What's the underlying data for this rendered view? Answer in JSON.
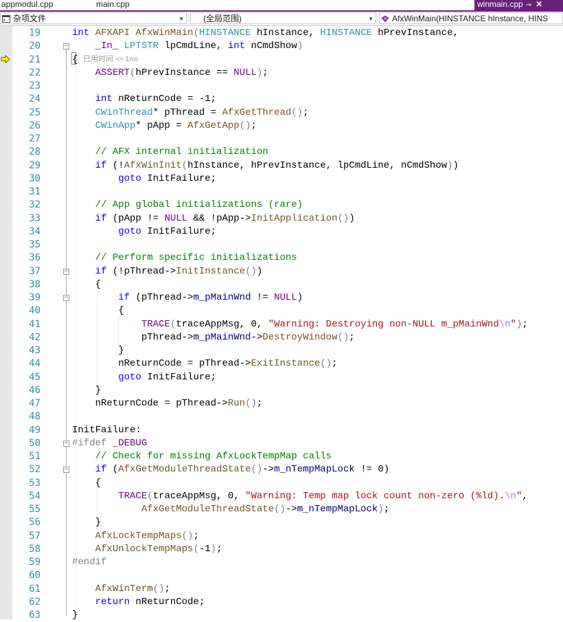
{
  "tabs": [
    {
      "label": "appmodul.cpp",
      "active": false
    },
    {
      "label": "main.cpp",
      "active": false
    },
    {
      "label": "winmain.cpp",
      "active": true
    }
  ],
  "active_tab_color": "#68217a",
  "nav": {
    "project": "杂项文件",
    "scope": "(全局范围)",
    "member": "AfxWinMain(HINSTANCE hInstance, HINS"
  },
  "perf_tip": {
    "label": "已用时间",
    "value": "<= 1ms"
  },
  "line_numbers": [
    "19",
    "20",
    "21",
    "22",
    "23",
    "24",
    "25",
    "26",
    "27",
    "28",
    "29",
    "30",
    "31",
    "32",
    "33",
    "34",
    "35",
    "36",
    "37",
    "38",
    "39",
    "40",
    "41",
    "42",
    "43",
    "44",
    "45",
    "46",
    "47",
    "48",
    "49",
    "50",
    "51",
    "52",
    "53",
    "54",
    "55",
    "56",
    "57",
    "58",
    "59",
    "60",
    "61",
    "62",
    "63"
  ],
  "code_lines": [
    [
      [
        "kw",
        "int "
      ],
      [
        "fn",
        "AFXAPI AfxWinMain"
      ],
      [
        "pa",
        "("
      ],
      [
        "ty",
        "HINSTANCE "
      ],
      [
        "lb",
        "hInstance, "
      ],
      [
        "ty",
        "HINSTANCE "
      ],
      [
        "lb",
        "hPrevInstance,"
      ]
    ],
    [
      [
        "lb",
        "    "
      ],
      [
        "mac",
        "_In_ "
      ],
      [
        "ty",
        "LPTSTR "
      ],
      [
        "lb",
        "lpCmdLine, "
      ],
      [
        "kw",
        "int "
      ],
      [
        "lb",
        "nCmdShow"
      ],
      [
        "pa",
        ")"
      ]
    ],
    [
      [
        "lb",
        "{"
      ]
    ],
    [
      [
        "lb",
        "    "
      ],
      [
        "mac",
        "ASSERT"
      ],
      [
        "pa",
        "("
      ],
      [
        "lb",
        "hPrevInstance == "
      ],
      [
        "mac",
        "NULL"
      ],
      [
        "pa",
        ")"
      ],
      [
        "lb",
        ";"
      ]
    ],
    [],
    [
      [
        "lb",
        "    "
      ],
      [
        "kw",
        "int "
      ],
      [
        "lb",
        "nReturnCode = -1;"
      ]
    ],
    [
      [
        "lb",
        "    "
      ],
      [
        "ty",
        "CWinThread"
      ],
      [
        "lb",
        "* pThread = "
      ],
      [
        "fn",
        "AfxGetThread"
      ],
      [
        "pa",
        "()"
      ],
      [
        "lb",
        ";"
      ]
    ],
    [
      [
        "lb",
        "    "
      ],
      [
        "ty",
        "CWinApp"
      ],
      [
        "lb",
        "* pApp = "
      ],
      [
        "fn",
        "AfxGetApp"
      ],
      [
        "pa",
        "()"
      ],
      [
        "lb",
        ";"
      ]
    ],
    [],
    [
      [
        "lb",
        "    "
      ],
      [
        "cm",
        "// AFX internal initialization"
      ]
    ],
    [
      [
        "lb",
        "    "
      ],
      [
        "kw",
        "if "
      ],
      [
        "lb",
        "(!"
      ],
      [
        "fn",
        "AfxWinInit"
      ],
      [
        "pa",
        "("
      ],
      [
        "lb",
        "hInstance, hPrevInstance, lpCmdLine, nCmdShow"
      ],
      [
        "pa",
        ")"
      ],
      [
        "lb",
        ")"
      ]
    ],
    [
      [
        "lb",
        "        "
      ],
      [
        "kw",
        "goto "
      ],
      [
        "lb",
        "InitFailure;"
      ]
    ],
    [],
    [
      [
        "lb",
        "    "
      ],
      [
        "cm",
        "// App global initializations (rare)"
      ]
    ],
    [
      [
        "lb",
        "    "
      ],
      [
        "kw",
        "if "
      ],
      [
        "lb",
        "(pApp != "
      ],
      [
        "mac",
        "NULL"
      ],
      [
        "lb",
        " && !pApp->"
      ],
      [
        "fn",
        "InitApplication"
      ],
      [
        "pa",
        "()"
      ],
      [
        "lb",
        ")"
      ]
    ],
    [
      [
        "lb",
        "        "
      ],
      [
        "kw",
        "goto "
      ],
      [
        "lb",
        "InitFailure;"
      ]
    ],
    [],
    [
      [
        "lb",
        "    "
      ],
      [
        "cm",
        "// Perform specific initializations"
      ]
    ],
    [
      [
        "lb",
        "    "
      ],
      [
        "kw",
        "if "
      ],
      [
        "lb",
        "(!pThread->"
      ],
      [
        "fn",
        "InitInstance"
      ],
      [
        "pa",
        "()"
      ],
      [
        "lb",
        ")"
      ]
    ],
    [
      [
        "lb",
        "    {"
      ]
    ],
    [
      [
        "lb",
        "        "
      ],
      [
        "kw",
        "if "
      ],
      [
        "lb",
        "(pThread->"
      ],
      [
        "mem",
        "m_pMainWnd"
      ],
      [
        "lb",
        " != "
      ],
      [
        "mac",
        "NULL"
      ],
      [
        "lb",
        ")"
      ]
    ],
    [
      [
        "lb",
        "        {"
      ]
    ],
    [
      [
        "lb",
        "            "
      ],
      [
        "mac",
        "TRACE"
      ],
      [
        "pa",
        "("
      ],
      [
        "lb",
        "traceAppMsg, 0, "
      ],
      [
        "st",
        "\"Warning: Destroying non-NULL m_pMainWnd"
      ],
      [
        "esc",
        "\\n"
      ],
      [
        "st",
        "\""
      ],
      [
        "pa",
        ")"
      ],
      [
        "lb",
        ";"
      ]
    ],
    [
      [
        "lb",
        "            pThread->"
      ],
      [
        "mem",
        "m_pMainWnd"
      ],
      [
        "lb",
        "->"
      ],
      [
        "fn",
        "DestroyWindow"
      ],
      [
        "pa",
        "()"
      ],
      [
        "lb",
        ";"
      ]
    ],
    [
      [
        "lb",
        "        }"
      ]
    ],
    [
      [
        "lb",
        "        nReturnCode = pThread->"
      ],
      [
        "fn",
        "ExitInstance"
      ],
      [
        "pa",
        "()"
      ],
      [
        "lb",
        ";"
      ]
    ],
    [
      [
        "lb",
        "        "
      ],
      [
        "kw",
        "goto "
      ],
      [
        "lb",
        "InitFailure;"
      ]
    ],
    [
      [
        "lb",
        "    }"
      ]
    ],
    [
      [
        "lb",
        "    nReturnCode = pThread->"
      ],
      [
        "fn",
        "Run"
      ],
      [
        "pa",
        "()"
      ],
      [
        "lb",
        ";"
      ]
    ],
    [],
    [
      [
        "lb",
        "InitFailure:"
      ]
    ],
    [
      [
        "pa",
        "#ifdef "
      ],
      [
        "mac",
        "_DEBUG"
      ]
    ],
    [
      [
        "lb",
        "    "
      ],
      [
        "cm",
        "// Check for missing AfxLockTempMap calls"
      ]
    ],
    [
      [
        "lb",
        "    "
      ],
      [
        "kw",
        "if "
      ],
      [
        "lb",
        "("
      ],
      [
        "fn",
        "AfxGetModuleThreadState"
      ],
      [
        "pa",
        "()"
      ],
      [
        "lb",
        "->"
      ],
      [
        "mem",
        "m_nTempMapLock"
      ],
      [
        "lb",
        " != 0)"
      ]
    ],
    [
      [
        "lb",
        "    {"
      ]
    ],
    [
      [
        "lb",
        "        "
      ],
      [
        "mac",
        "TRACE"
      ],
      [
        "pa",
        "("
      ],
      [
        "lb",
        "traceAppMsg, 0, "
      ],
      [
        "st",
        "\"Warning: Temp map lock count non-zero (%ld)."
      ],
      [
        "esc",
        "\\n"
      ],
      [
        "st",
        "\""
      ],
      [
        "lb",
        ","
      ]
    ],
    [
      [
        "lb",
        "            "
      ],
      [
        "fn",
        "AfxGetModuleThreadState"
      ],
      [
        "pa",
        "()"
      ],
      [
        "lb",
        "->"
      ],
      [
        "mem",
        "m_nTempMapLock"
      ],
      [
        "pa",
        ")"
      ],
      [
        "lb",
        ";"
      ]
    ],
    [
      [
        "lb",
        "    }"
      ]
    ],
    [
      [
        "lb",
        "    "
      ],
      [
        "fn",
        "AfxLockTempMaps"
      ],
      [
        "pa",
        "()"
      ],
      [
        "lb",
        ";"
      ]
    ],
    [
      [
        "lb",
        "    "
      ],
      [
        "fn",
        "AfxUnlockTempMaps"
      ],
      [
        "pa",
        "("
      ],
      [
        "lb",
        "-1"
      ],
      [
        "pa",
        ")"
      ],
      [
        "lb",
        ";"
      ]
    ],
    [
      [
        "pa",
        "#endif"
      ]
    ],
    [],
    [
      [
        "lb",
        "    "
      ],
      [
        "fn",
        "AfxWinTerm"
      ],
      [
        "pa",
        "()"
      ],
      [
        "lb",
        ";"
      ]
    ],
    [
      [
        "lb",
        "    "
      ],
      [
        "kw",
        "return "
      ],
      [
        "lb",
        "nReturnCode;"
      ]
    ],
    [
      [
        "lb",
        "}"
      ]
    ]
  ],
  "fold_markers": [
    "20",
    "37",
    "39",
    "50",
    "52"
  ],
  "current_line": "21"
}
